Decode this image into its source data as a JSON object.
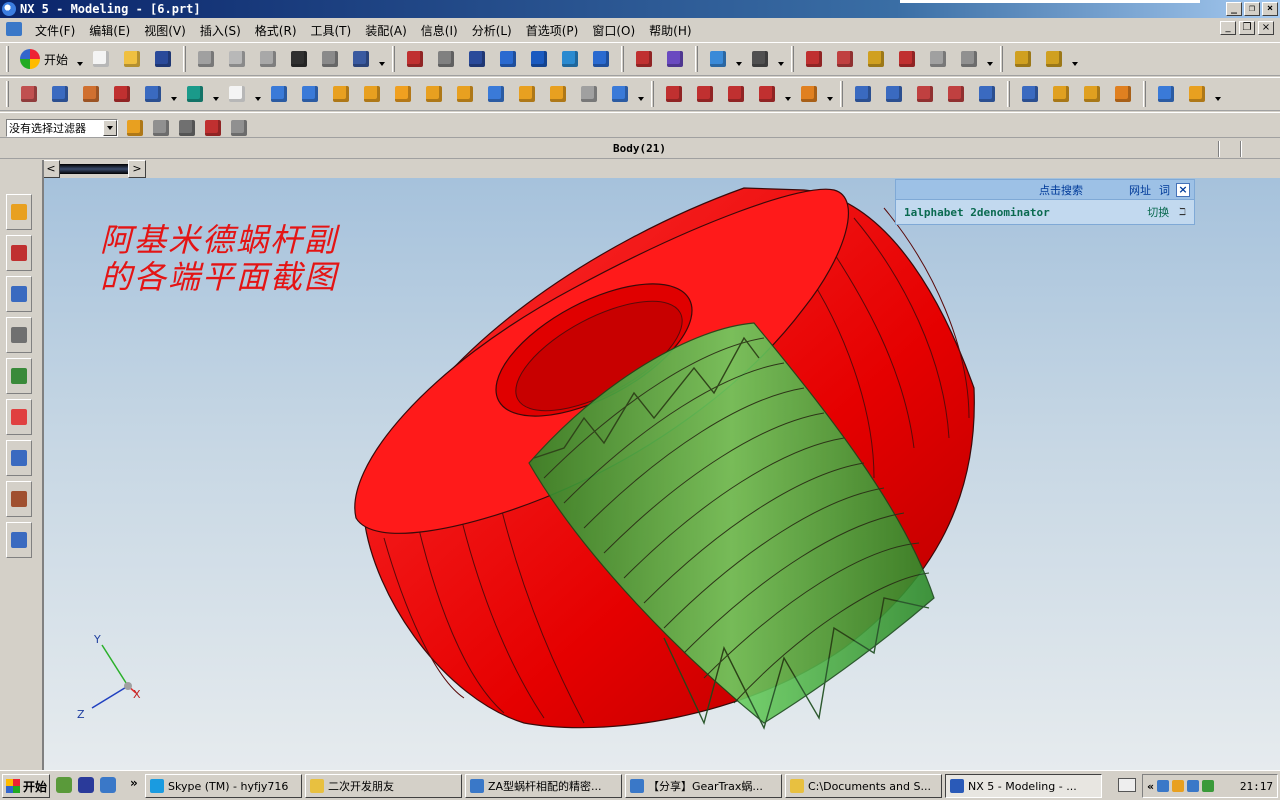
{
  "window": {
    "title": "NX 5 - Modeling - [6.prt]",
    "controls": [
      "minimize",
      "maximize",
      "close"
    ]
  },
  "menubar": {
    "items": [
      "文件(F)",
      "编辑(E)",
      "视图(V)",
      "插入(S)",
      "格式(R)",
      "工具(T)",
      "装配(A)",
      "信息(I)",
      "分析(L)",
      "首选项(P)",
      "窗口(O)",
      "帮助(H)"
    ]
  },
  "toolbar": {
    "start_label": "开始",
    "filter": {
      "value": "没有选择过滤器"
    }
  },
  "status": {
    "text": "Body(21)"
  },
  "viewport": {
    "title_line1": "阿基米德蜗杆副",
    "title_line2": "的各端平面截图",
    "triad": {
      "x": "X",
      "y": "Y",
      "z": "Z"
    },
    "colors": {
      "wheel": "#ff1a1a",
      "worm": "#44b040",
      "edge": "#3a0a0a"
    }
  },
  "search_widget": {
    "label": "点击搜索",
    "btn_web": "网址",
    "btn_word": "词",
    "close": "×",
    "term": "1alphabet 2denominator",
    "switch": "切换",
    "bracket": "ℶ"
  },
  "taskbar": {
    "start": "开始",
    "chevron": "»",
    "tasks": [
      {
        "label": "Skype (TM) - hyfjy716",
        "icon": "skype-icon",
        "color": "#1a9be0"
      },
      {
        "label": "二次开发朋友",
        "icon": "folder-icon",
        "color": "#e8c040"
      },
      {
        "label": "ZA型蜗杆相配的精密...",
        "icon": "ie-icon",
        "color": "#3a78c8"
      },
      {
        "label": "【分享】GearTrax蜗...",
        "icon": "ie-icon",
        "color": "#3a78c8"
      },
      {
        "label": "C:\\Documents and S...",
        "icon": "folder-icon",
        "color": "#e8c040"
      },
      {
        "label": "NX 5 - Modeling - ...",
        "icon": "nx-icon",
        "color": "#2a5ab8"
      }
    ],
    "tray_chevron": "«",
    "clock": "21:17"
  }
}
